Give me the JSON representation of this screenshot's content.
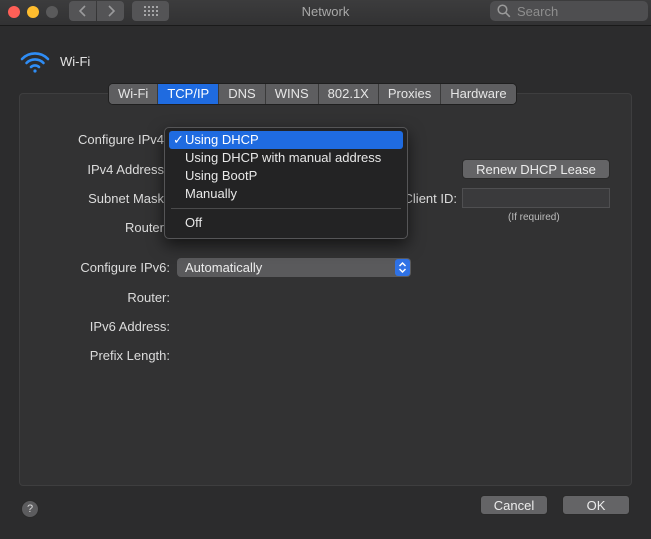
{
  "window": {
    "title": "Network"
  },
  "search": {
    "placeholder": "Search"
  },
  "header": {
    "network_name": "Wi-Fi"
  },
  "tabs": [
    "Wi-Fi",
    "TCP/IP",
    "DNS",
    "WINS",
    "802.1X",
    "Proxies",
    "Hardware"
  ],
  "selected_tab": "TCP/IP",
  "ipv4": {
    "configure_label": "Configure IPv4",
    "address_label": "IPv4 Address",
    "subnet_label": "Subnet Mask",
    "router_label": "Router",
    "renew_button": "Renew DHCP Lease",
    "client_id_label": "Client ID:",
    "client_id_value": "",
    "client_id_hint": "(If required)"
  },
  "ipv4_menu": {
    "items": [
      "Using DHCP",
      "Using DHCP with manual address",
      "Using BootP",
      "Manually",
      "Off"
    ],
    "selected": "Using DHCP",
    "check": "✓"
  },
  "ipv6": {
    "configure_label": "Configure IPv6:",
    "configure_value": "Automatically",
    "router_label": "Router:",
    "address_label": "IPv6 Address:",
    "prefix_label": "Prefix Length:"
  },
  "footer": {
    "help": "?",
    "cancel": "Cancel",
    "ok": "OK"
  },
  "colors": {
    "accent": "#1f6be0",
    "background": "#2c2c2d"
  }
}
